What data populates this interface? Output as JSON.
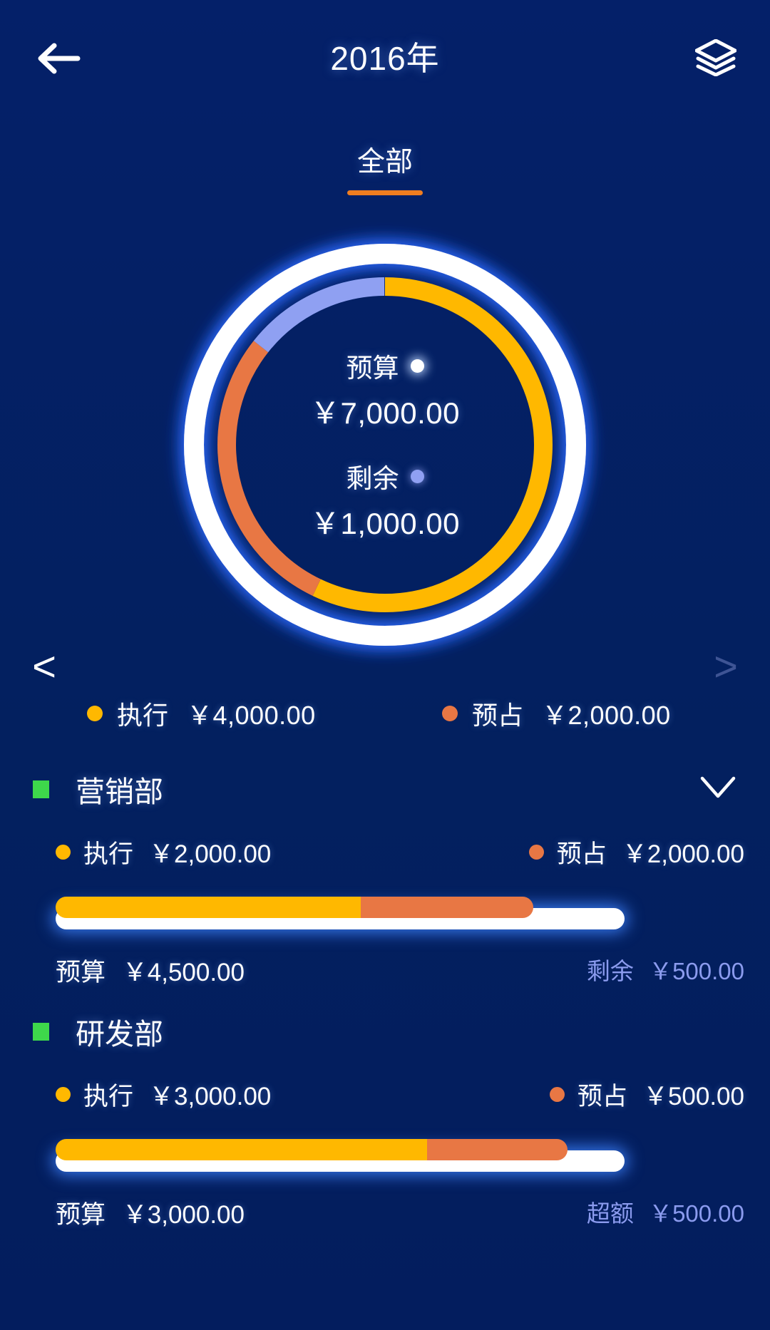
{
  "header": {
    "title": "2016年",
    "back_icon": "arrow-left-icon",
    "layers_icon": "layers-icon"
  },
  "tabs": [
    {
      "label": "全部",
      "active": true
    }
  ],
  "carousel": {
    "prev_label": "<",
    "next_label": ">"
  },
  "donut": {
    "budget_label": "预算",
    "budget_value": "￥7,000.00",
    "remain_label": "剩余",
    "remain_value": "￥1,000.00"
  },
  "overall_legend": [
    {
      "label": "执行",
      "value": "￥4,000.00",
      "color": "#FFB800"
    },
    {
      "label": "预占",
      "value": "￥2,000.00",
      "color": "#E87744"
    }
  ],
  "departments": [
    {
      "name": "营销部",
      "marker_color": "#3ED84B",
      "collapse_icon": "chevron-down-icon",
      "exec_label": "执行",
      "exec_value": "￥2,000.00",
      "pre_label": "预占",
      "pre_value": "￥2,000.00",
      "budget_label": "预算",
      "budget_value": "￥4,500.00",
      "status_label": "剩余",
      "status_value": "￥500.00"
    },
    {
      "name": "研发部",
      "marker_color": "#3ED84B",
      "collapse_icon": "chevron-down-icon",
      "exec_label": "执行",
      "exec_value": "￥3,000.00",
      "pre_label": "预占",
      "pre_value": "￥500.00",
      "budget_label": "预算",
      "budget_value": "￥3,000.00",
      "status_label": "超额",
      "status_value": "￥500.00"
    }
  ],
  "colors": {
    "background": "#04206A",
    "exec": "#FFB800",
    "preoccupy": "#E87744",
    "remain": "#8FA0F2",
    "budget_ring": "#FFFFFF",
    "accent_underline": "#F07D1F",
    "dept_marker": "#3ED84B",
    "muted_text": "#8B9BEE"
  },
  "chart_data": {
    "type": "pie",
    "title": "2016年 全部 预算执行",
    "total_label": "预算",
    "total": 7000,
    "currency": "￥",
    "labels": [
      "执行",
      "预占",
      "剩余"
    ],
    "values": [
      4000,
      2000,
      1000
    ],
    "percentages": [
      57.1,
      28.6,
      14.3
    ],
    "colors": [
      "#FFB800",
      "#E87744",
      "#8FA0F2"
    ],
    "start_angle_deg": 0,
    "direction": "clockwise",
    "donut": true,
    "legend": "bottom",
    "outer_ring": {
      "label": "预算",
      "value": 7000,
      "color": "#FFFFFF"
    },
    "bars": [
      {
        "name": "营销部",
        "type": "bar",
        "budget": 4500,
        "segments": [
          {
            "label": "执行",
            "value": 2000,
            "color": "#FFB800"
          },
          {
            "label": "预占",
            "value": 2000,
            "color": "#E87744"
          }
        ],
        "status": {
          "label": "剩余",
          "value": 500
        },
        "exec_pct": 44.4,
        "pre_pct": 44.4,
        "fill_pct": 88.9
      },
      {
        "name": "研发部",
        "type": "bar",
        "budget": 3000,
        "segments": [
          {
            "label": "执行",
            "value": 3000,
            "color": "#FFB800"
          },
          {
            "label": "预占",
            "value": 500,
            "color": "#E87744"
          }
        ],
        "status": {
          "label": "超额",
          "value": 500
        },
        "exec_pct": 100.0,
        "pre_pct": 16.7,
        "fill_pct": 116.7
      }
    ]
  }
}
